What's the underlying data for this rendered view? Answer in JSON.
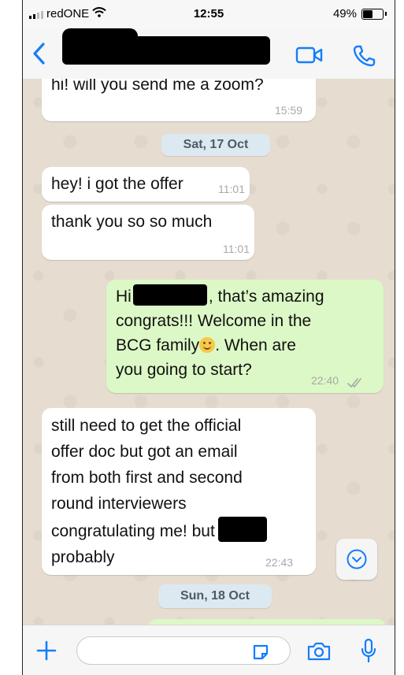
{
  "status_bar": {
    "carrier": "redONE",
    "time": "12:55",
    "battery_percent": "49%",
    "battery_level": 0.49
  },
  "header": {
    "contact_name": "",
    "icons": [
      "back-chevron-icon",
      "video-camera-icon",
      "phone-icon"
    ],
    "accent_color": "#147efb"
  },
  "messages": [
    {
      "direction": "in",
      "lines": [
        "hi! will you send me a zoom?"
      ],
      "time": "15:59"
    },
    {
      "type": "date",
      "label": "Sat, 17 Oct"
    },
    {
      "direction": "in",
      "lines": [
        "hey! i got the offer"
      ],
      "time": "11:01"
    },
    {
      "direction": "in",
      "lines": [
        "thank you so so much"
      ],
      "time": "11:01"
    },
    {
      "direction": "out",
      "lines": [
        "Hi",
        ", that’s amazing",
        "congrats!!! Welcome in the",
        "BCG family",
        ". When are",
        "you going to start?"
      ],
      "time": "22:40",
      "status": "read"
    },
    {
      "direction": "in",
      "lines": [
        "still need to get the official",
        "offer doc but got an email",
        "from both first and second",
        "round interviewers",
        "congratulating me! but",
        "probably"
      ],
      "time": "22:43"
    },
    {
      "type": "date",
      "label": "Sun, 18 Oct"
    }
  ],
  "input_bar": {
    "placeholder": "",
    "icons": [
      "plus-icon",
      "sticker-icon",
      "camera-icon",
      "microphone-icon"
    ]
  },
  "colors": {
    "chat_background": "#e6ddd0",
    "incoming_bubble": "#ffffff",
    "outgoing_bubble": "#dcf8c6",
    "date_pill": "#dde9f1",
    "ios_blue": "#147efb"
  }
}
